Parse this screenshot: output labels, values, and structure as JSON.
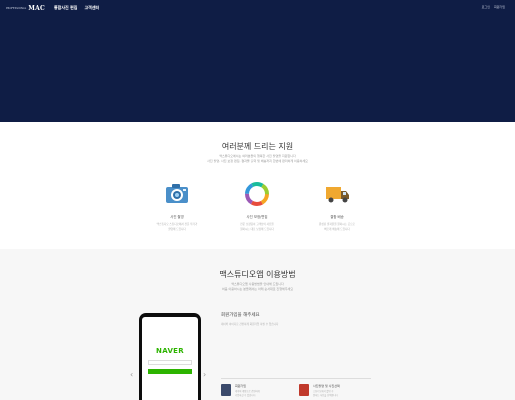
{
  "brand": {
    "small": "PROFESSIONAL",
    "main": "MAC"
  },
  "nav": {
    "items": [
      "통합사진 편집",
      "고객센터"
    ],
    "right": [
      "로그인",
      "회원가입"
    ]
  },
  "section1": {
    "title": "여러분께 드리는 지원",
    "sub1": "맥스튜디오에서는 여러분들의 행복한 사진 촬영을 지원합니다",
    "sub2": "사진 촬영, 사진 보정 편집, 결과물 출력 및 배송까지 한번에 편리하게 이용하세요",
    "features": [
      {
        "title": "사진 촬영",
        "desc1": "맥스튜디오 스튜디오에서 전문 작가가",
        "desc2": "촬영해 드립니다",
        "icon": "camera-icon"
      },
      {
        "title": "사진 보정/편집",
        "desc1": "전문 보정팀이 고객님의 사진을",
        "desc2": "원하시는 대로 보정해 드립니다",
        "icon": "color-wheel-icon"
      },
      {
        "title": "결합 배송",
        "desc1": "완성된 결과물을 원하시는 곳으로",
        "desc2": "빠르게 배송해 드립니다",
        "icon": "truck-icon"
      }
    ]
  },
  "section2": {
    "title": "맥스튜디오앱 이용방법",
    "sub1": "맥스튜디오앱 사용방법을 안내해 드립니다",
    "sub2": "처음 이용하시는 분들께서는 아래 순서대로 진행해주세요",
    "phone_logo": "NAVER",
    "step_title": "회원가입을 해주세요",
    "step_desc": "네이버 아이디로 간편하게 회원가입 하실 수 있습니다",
    "mini_steps": [
      {
        "title": "회원가입",
        "desc1": "네이버 계정으로 간편하게",
        "desc2": "가입하실 수 있습니다"
      },
      {
        "title": "사진촬영 및 사진선택",
        "desc1": "스튜디오에서 촬영 후",
        "desc2": "원하는 사진을 선택합니다"
      }
    ]
  },
  "colors": {
    "hero": "#0f1d45",
    "naver": "#2db400"
  }
}
